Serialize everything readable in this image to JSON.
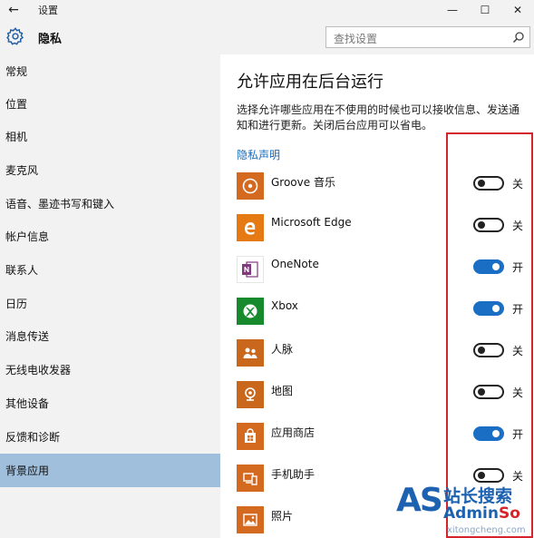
{
  "window": {
    "title": "设置",
    "back_glyph": "←",
    "minimize_glyph": "—",
    "maximize_glyph": "☐",
    "close_glyph": "✕"
  },
  "header": {
    "section": "隐私",
    "search_placeholder": "查找设置"
  },
  "sidebar": {
    "active_index": 13,
    "items": [
      {
        "label": "常规"
      },
      {
        "label": "位置"
      },
      {
        "label": "相机"
      },
      {
        "label": "麦克风"
      },
      {
        "label": "语音、墨迹书写和键入"
      },
      {
        "label": "帐户信息"
      },
      {
        "label": "联系人"
      },
      {
        "label": "日历"
      },
      {
        "label": "消息传送"
      },
      {
        "label": "无线电收发器"
      },
      {
        "label": "其他设备"
      },
      {
        "label": "反馈和诊断"
      },
      {
        "label": "背景应用"
      }
    ]
  },
  "content": {
    "title": "允许应用在后台运行",
    "description": "选择允许哪些应用在不使用的时候也可以接收信息、发送通知和进行更新。关闭后台应用可以省电。",
    "privacy_link": "隐私声明",
    "apps": [
      {
        "name": "Groove 音乐",
        "icon": "groove-music-icon",
        "icon_color": "#d46a1f",
        "on": false,
        "state": "关"
      },
      {
        "name": "Microsoft Edge",
        "icon": "edge-icon",
        "icon_color": "#e57a14",
        "on": false,
        "state": "关"
      },
      {
        "name": "OneNote",
        "icon": "onenote-icon",
        "icon_color": "#ffffff",
        "on": true,
        "state": "开"
      },
      {
        "name": "Xbox",
        "icon": "xbox-icon",
        "icon_color": "#178a2e",
        "on": true,
        "state": "开"
      },
      {
        "name": "人脉",
        "icon": "people-icon",
        "icon_color": "#c9671c",
        "on": false,
        "state": "关"
      },
      {
        "name": "地图",
        "icon": "maps-icon",
        "icon_color": "#c9671c",
        "on": false,
        "state": "关"
      },
      {
        "name": "应用商店",
        "icon": "store-icon",
        "icon_color": "#d46a1f",
        "on": true,
        "state": "开"
      },
      {
        "name": "手机助手",
        "icon": "phone-companion-icon",
        "icon_color": "#d46a1f",
        "on": false,
        "state": "关"
      },
      {
        "name": "照片",
        "icon": "photos-icon",
        "icon_color": "#d46a1f",
        "on": null,
        "state": ""
      }
    ]
  },
  "colors": {
    "accent": "#1a6fc4",
    "highlight_box": "#d4232a",
    "active_nav": "#9fbfdc"
  },
  "watermark": {
    "logo": "AS",
    "cn": "站长搜索",
    "en_a": "Admin",
    "en_b": "So",
    "url": "xitongcheng.com"
  }
}
